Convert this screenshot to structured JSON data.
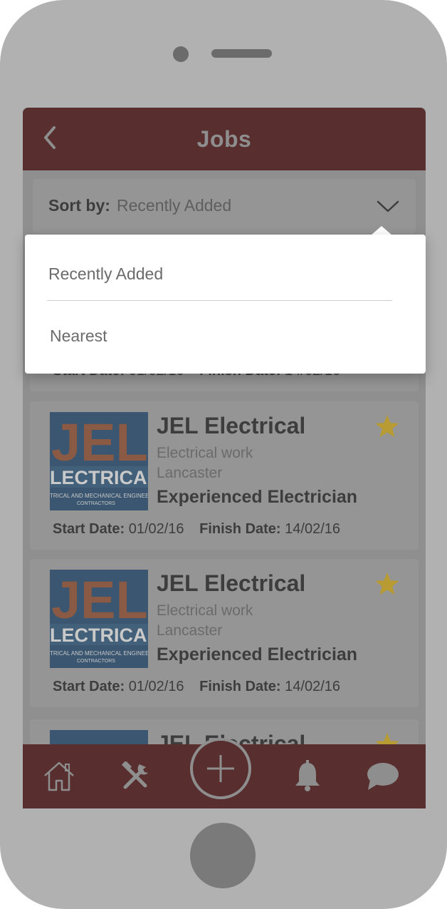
{
  "header": {
    "title": "Jobs",
    "back_icon": "chevron-left-icon"
  },
  "sort": {
    "label": "Sort by:",
    "value": "Recently Added",
    "toggle_icon": "chevron-down-icon",
    "options": [
      "Recently Added",
      "Nearest"
    ]
  },
  "cards": [
    {
      "start_label": "Start Date:",
      "start_value": "01/02/16",
      "finish_label": "Finish Date:",
      "finish_value": "14/02/16"
    },
    {
      "logo_text": "JEL",
      "logo_sub": "LECTRICAL LT",
      "logo_tagline": "TRICAL AND MECHANICAL ENGINEER",
      "logo_tagline2": "CONTRACTORS",
      "company": "JEL Electrical",
      "category": "Electrical work",
      "location": "Lancaster",
      "job_title": "Experienced Electrician",
      "start_label": "Start Date:",
      "start_value": "01/02/16",
      "finish_label": "Finish Date:",
      "finish_value": "14/02/16",
      "favorite_icon": "star-icon"
    },
    {
      "logo_text": "JEL",
      "logo_sub": "LECTRICAL LT",
      "logo_tagline": "TRICAL AND MECHANICAL ENGINEER",
      "logo_tagline2": "CONTRACTORS",
      "company": "JEL Electrical",
      "category": "Electrical work",
      "location": "Lancaster",
      "job_title": "Experienced Electrician",
      "start_label": "Start Date:",
      "start_value": "01/02/16",
      "finish_label": "Finish Date:",
      "finish_value": "14/02/16",
      "favorite_icon": "star-icon"
    },
    {
      "company": "JEL Electrical",
      "favorite_icon": "star-icon"
    }
  ],
  "tabbar": {
    "items": [
      "home-icon",
      "tools-icon",
      "add-icon",
      "bell-icon",
      "chat-bubble-icon"
    ]
  },
  "colors": {
    "header_bg": "#582e2e",
    "screen_overlay": "#8f8f8f",
    "star": "#b99b33",
    "dropdown_bg": "#ffffff"
  }
}
